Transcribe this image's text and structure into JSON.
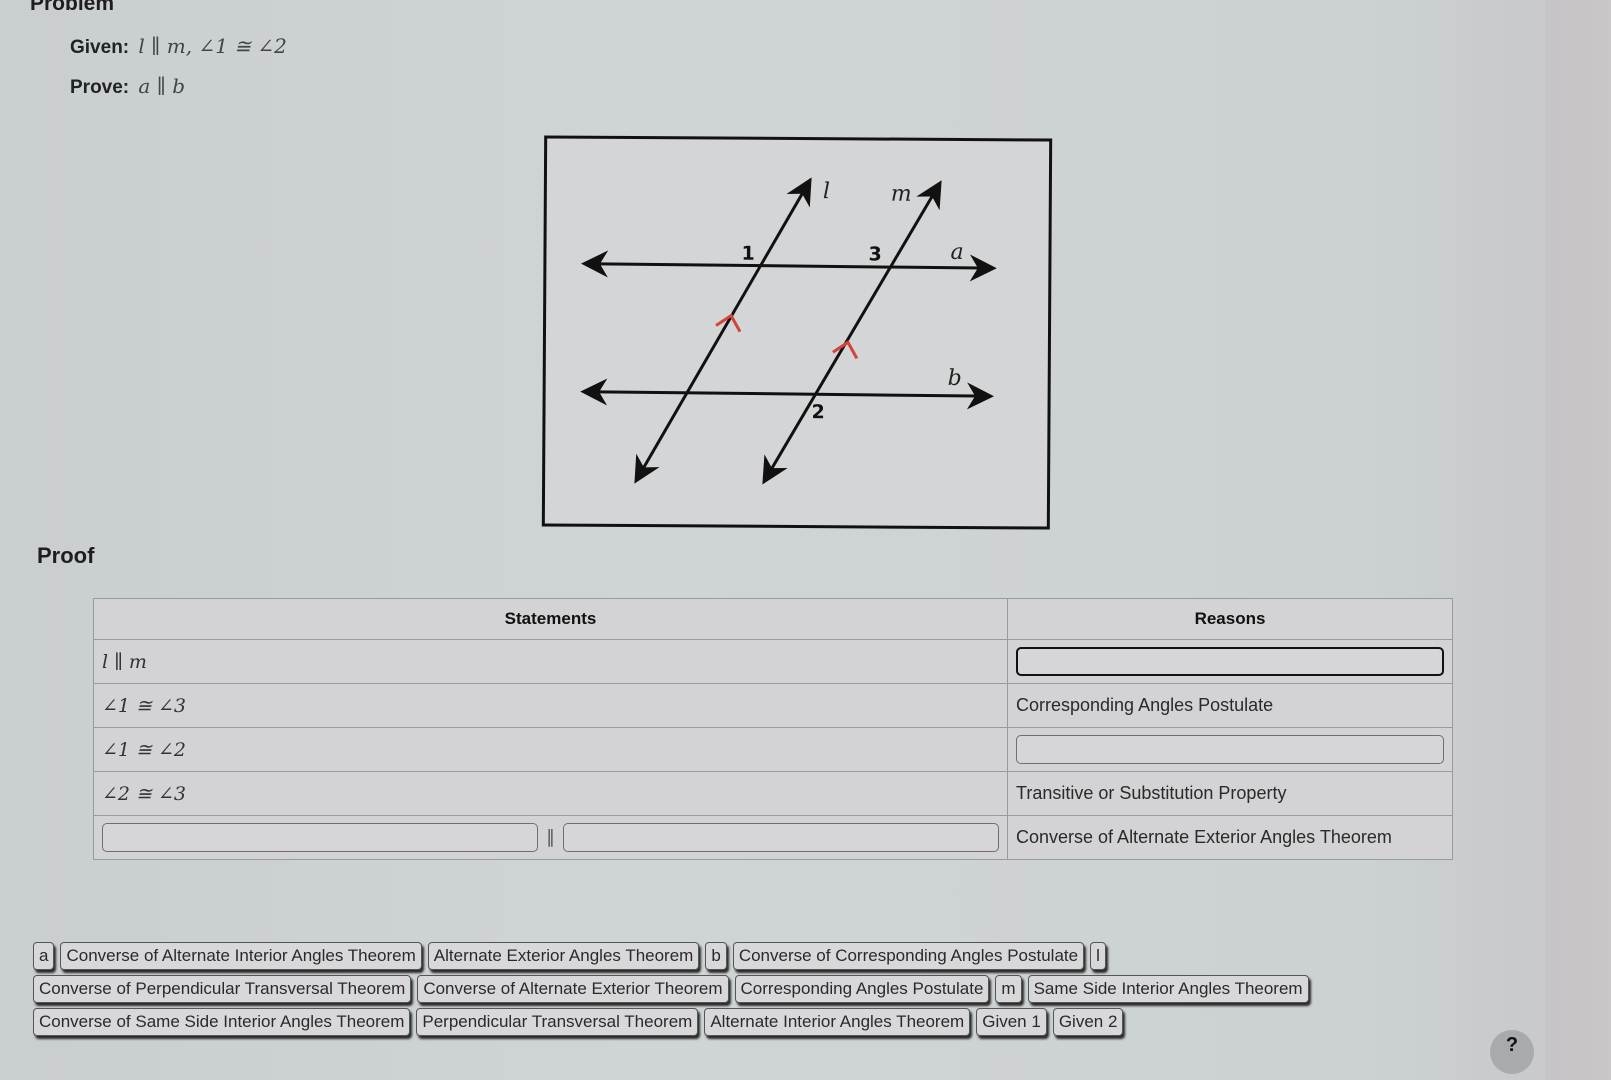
{
  "problem": {
    "title": "Problem",
    "given_label": "Given:",
    "given_math": "l ∥ m, ∠1 ≅ ∠2",
    "prove_label": "Prove:",
    "prove_math": "a ∥ b"
  },
  "figure": {
    "line_labels": {
      "l": "l",
      "m": "m",
      "a": "a",
      "b": "b"
    },
    "angle_labels": {
      "1": "1",
      "2": "2",
      "3": "3"
    },
    "parallel_mark_color": "#d0443a"
  },
  "proof": {
    "title": "Proof",
    "headers": {
      "statements": "Statements",
      "reasons": "Reasons"
    },
    "rows": [
      {
        "statement": "l ∥ m",
        "reason": ""
      },
      {
        "statement": "∠1 ≅ ∠3",
        "reason": "Corresponding Angles Postulate"
      },
      {
        "statement": "∠1 ≅ ∠2",
        "reason": ""
      },
      {
        "statement": "∠2 ≅ ∠3",
        "reason": "Transitive or Substitution Property"
      },
      {
        "statement_left": "",
        "statement_symbol": "∥",
        "statement_right": "",
        "reason": "Converse of Alternate Exterior Angles Theorem"
      }
    ]
  },
  "answer_bank": {
    "rows": [
      [
        "a",
        "Converse of Alternate Interior Angles Theorem",
        "Alternate Exterior Angles Theorem",
        "b",
        "Converse of Corresponding Angles Postulate",
        "l"
      ],
      [
        "Converse of Perpendicular Transversal Theorem",
        "Converse of Alternate Exterior Theorem",
        "Corresponding Angles Postulate",
        "m",
        "Same Side Interior Angles Theorem"
      ],
      [
        "Converse of Same Side Interior Angles Theorem",
        "Perpendicular Transversal Theorem",
        "Alternate Interior Angles Theorem",
        "Given 1",
        "Given 2"
      ]
    ]
  },
  "help": {
    "label": "?"
  }
}
